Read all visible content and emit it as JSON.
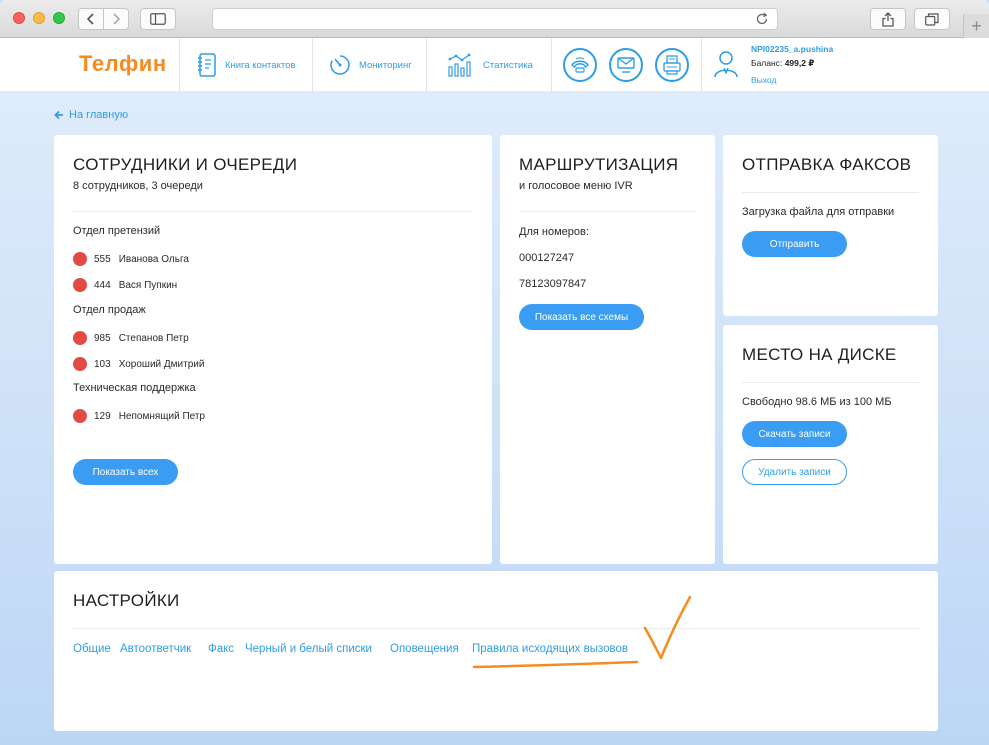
{
  "browser": {
    "plus_label": "+"
  },
  "header": {
    "logo": "Телфин",
    "nav": [
      {
        "label": "Книга контактов",
        "icon": "contact-book-icon"
      },
      {
        "label": "Мониторинг",
        "icon": "monitoring-gauge-icon"
      },
      {
        "label": "Статистика",
        "icon": "statistics-chart-icon"
      }
    ],
    "action_icons": [
      "phone-icon",
      "envelope-icon",
      "fax-icon"
    ],
    "user": {
      "login": "NPI02235_a.pushina",
      "balance_label": "Баланс:",
      "balance_value": "499,2 ₽",
      "logout": "Выход"
    }
  },
  "back_link": "На главную",
  "employees_card": {
    "title": "СОТРУДНИКИ И ОЧЕРЕДИ",
    "subtitle": "8 сотрудников, 3 очереди",
    "groups": [
      {
        "name": "Отдел претензий",
        "employees": [
          {
            "ext": "555",
            "name": "Иванова Ольга"
          },
          {
            "ext": "444",
            "name": "Вася Пупкин"
          }
        ]
      },
      {
        "name": "Отдел продаж",
        "employees": [
          {
            "ext": "985",
            "name": "Степанов Петр"
          },
          {
            "ext": "103",
            "name": "Хороший Дмитрий"
          }
        ]
      },
      {
        "name": "Техническая поддержка",
        "employees": [
          {
            "ext": "129",
            "name": "Непомнящий Петр"
          }
        ]
      }
    ],
    "show_all_button": "Показать всех",
    "status_color": "#e14b43"
  },
  "routing_card": {
    "title": "МАРШРУТИЗАЦИЯ",
    "subtitle": "и голосовое меню IVR",
    "numbers_label": "Для номеров:",
    "numbers": [
      "000127247",
      "78123097847"
    ],
    "show_schemes_button": "Показать все схемы"
  },
  "fax_card": {
    "title": "ОТПРАВКА ФАКСОВ",
    "upload_label": "Загрузка файла для отправки",
    "send_button": "Отправить"
  },
  "disk_card": {
    "title": "МЕСТО НА ДИСКЕ",
    "free_space": "Свободно 98.6 МБ из 100 МБ",
    "download_button": "Скачать записи",
    "delete_button": "Удалить записи"
  },
  "settings_card": {
    "title": "НАСТРОЙКИ",
    "links": [
      "Общие",
      "Автоответчик",
      "Факс",
      "Черный и белый списки",
      "Оповещения",
      "Правила исходящих вызовов"
    ]
  },
  "colors": {
    "accent": "#3a9cf2",
    "brand": "#f68b1f",
    "annotation": "#f68b1f"
  }
}
